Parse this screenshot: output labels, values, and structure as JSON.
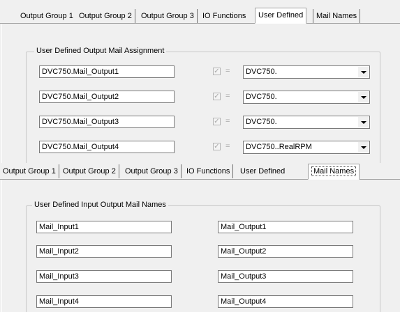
{
  "panel1": {
    "tabs": [
      "Output Group 1",
      "Output Group 2",
      "Output Group 3",
      "IO Functions",
      "User Defined",
      "Mail Names"
    ],
    "active_tab": "User Defined",
    "group_title": "User Defined Output Mail Assignment",
    "rows": [
      {
        "mail": "DVC750.Mail_Output1",
        "checked": true,
        "eq": "=",
        "combo": "DVC750."
      },
      {
        "mail": "DVC750.Mail_Output2",
        "checked": true,
        "eq": "=",
        "combo": "DVC750."
      },
      {
        "mail": "DVC750.Mail_Output3",
        "checked": true,
        "eq": "=",
        "combo": "DVC750."
      },
      {
        "mail": "DVC750.Mail_Output4",
        "checked": true,
        "eq": "=",
        "combo": "DVC750..RealRPM"
      }
    ]
  },
  "panel2": {
    "tabs": [
      "Output Group 1",
      "Output Group 2",
      "Output Group 3",
      "IO Functions",
      "User Defined",
      "Mail Names"
    ],
    "active_tab": "Mail Names",
    "group_title": "User Defined Input Output Mail Names",
    "inputs": [
      "Mail_Input1",
      "Mail_Input2",
      "Mail_Input3",
      "Mail_Input4"
    ],
    "outputs": [
      "Mail_Output1",
      "Mail_Output2",
      "Mail_Output3",
      "Mail_Output4"
    ]
  }
}
